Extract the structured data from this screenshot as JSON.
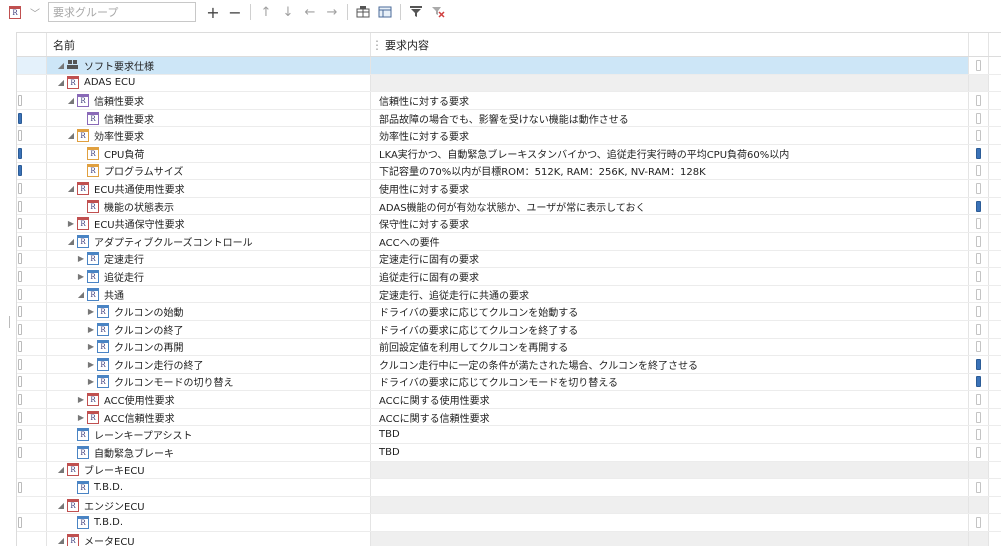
{
  "toolbar": {
    "group_placeholder": "要求グループ",
    "icons": [
      "requirement-icon",
      "dropdown-icon",
      "add-icon",
      "remove-icon",
      "move-up-icon",
      "move-down-icon",
      "move-left-icon",
      "move-right-icon",
      "table-icon",
      "image-icon",
      "filter-icon",
      "clear-filter-icon"
    ]
  },
  "columns": {
    "name": "名前",
    "content": "要求内容"
  },
  "rows": [
    {
      "level": 0,
      "toggle": "open",
      "icon": "package",
      "name": "ソフト要求仕様",
      "content": "",
      "mark": "none",
      "extra": false,
      "selected": true,
      "grey": false
    },
    {
      "level": 0,
      "toggle": "open",
      "icon": "red",
      "name": "ADAS ECU",
      "content": "",
      "mark": "none",
      "extra": false,
      "selected": false,
      "grey": true
    },
    {
      "level": 1,
      "toggle": "open",
      "icon": "purple",
      "name": "信頼性要求",
      "content": "信頼性に対する要求",
      "mark": "off",
      "extra": false,
      "selected": false,
      "grey": false
    },
    {
      "level": 2,
      "toggle": "none",
      "icon": "purple",
      "name": "信頼性要求",
      "content": "部品故障の場合でも、影響を受けない機能は動作させる",
      "mark": "on",
      "extra": false,
      "selected": false,
      "grey": false
    },
    {
      "level": 1,
      "toggle": "open",
      "icon": "orange",
      "name": "効率性要求",
      "content": "効率性に対する要求",
      "mark": "off",
      "extra": false,
      "selected": false,
      "grey": false
    },
    {
      "level": 2,
      "toggle": "none",
      "icon": "orange",
      "name": "CPU負荷",
      "content": "LKA実行かつ、自動緊急ブレーキスタンバイかつ、追従走行実行時の平均CPU負荷60%以内",
      "mark": "on",
      "extra": true,
      "selected": false,
      "grey": false
    },
    {
      "level": 2,
      "toggle": "none",
      "icon": "orange",
      "name": "プログラムサイズ",
      "content": "下記容量の70%以内が目標ROM：512K, RAM：256K, NV-RAM：128K",
      "mark": "on",
      "extra": false,
      "selected": false,
      "grey": false
    },
    {
      "level": 1,
      "toggle": "open",
      "icon": "red",
      "name": "ECU共通使用性要求",
      "content": "使用性に対する要求",
      "mark": "off",
      "extra": false,
      "selected": false,
      "grey": false
    },
    {
      "level": 2,
      "toggle": "none",
      "icon": "red",
      "name": "機能の状態表示",
      "content": "ADAS機能の何が有効な状態か、ユーザが常に表示しておく",
      "mark": "off",
      "extra": true,
      "selected": false,
      "grey": false
    },
    {
      "level": 1,
      "toggle": "closed",
      "icon": "dark",
      "name": "ECU共通保守性要求",
      "content": "保守性に対する要求",
      "mark": "off",
      "extra": false,
      "selected": false,
      "grey": false
    },
    {
      "level": 1,
      "toggle": "open",
      "icon": "blue",
      "name": "アダプティブクルーズコントロール",
      "content": "ACCへの要件",
      "mark": "off",
      "extra": false,
      "selected": false,
      "grey": false
    },
    {
      "level": 2,
      "toggle": "closed",
      "icon": "blue",
      "name": "定速走行",
      "content": "定速走行に固有の要求",
      "mark": "off",
      "extra": false,
      "selected": false,
      "grey": false
    },
    {
      "level": 2,
      "toggle": "closed",
      "icon": "blue",
      "name": "追従走行",
      "content": "追従走行に固有の要求",
      "mark": "off",
      "extra": false,
      "selected": false,
      "grey": false
    },
    {
      "level": 2,
      "toggle": "open",
      "icon": "blue",
      "name": "共通",
      "content": "定速走行、追従走行に共通の要求",
      "mark": "off",
      "extra": false,
      "selected": false,
      "grey": false
    },
    {
      "level": 3,
      "toggle": "closed",
      "icon": "blue",
      "name": "クルコンの始動",
      "content": "ドライバの要求に応じてクルコンを始動する",
      "mark": "off",
      "extra": false,
      "selected": false,
      "grey": false
    },
    {
      "level": 3,
      "toggle": "closed",
      "icon": "blue",
      "name": "クルコンの終了",
      "content": "ドライバの要求に応じてクルコンを終了する",
      "mark": "off",
      "extra": false,
      "selected": false,
      "grey": false
    },
    {
      "level": 3,
      "toggle": "closed",
      "icon": "blue",
      "name": "クルコンの再開",
      "content": "前回設定値を利用してクルコンを再開する",
      "mark": "off",
      "extra": false,
      "selected": false,
      "grey": false
    },
    {
      "level": 3,
      "toggle": "closed",
      "icon": "blue",
      "name": "クルコン走行の終了",
      "content": "クルコン走行中に一定の条件が満たされた場合、クルコンを終了させる",
      "mark": "off",
      "extra": true,
      "selected": false,
      "grey": false
    },
    {
      "level": 3,
      "toggle": "closed",
      "icon": "blue",
      "name": "クルコンモードの切り替え",
      "content": "ドライバの要求に応じてクルコンモードを切り替える",
      "mark": "off",
      "extra": true,
      "selected": false,
      "grey": false
    },
    {
      "level": 2,
      "toggle": "closed",
      "icon": "red",
      "name": "ACC使用性要求",
      "content": "ACCに関する使用性要求",
      "mark": "off",
      "extra": false,
      "selected": false,
      "grey": false
    },
    {
      "level": 2,
      "toggle": "closed",
      "icon": "red",
      "name": "ACC信頼性要求",
      "content": "ACCに関する信頼性要求",
      "mark": "off",
      "extra": false,
      "selected": false,
      "grey": false
    },
    {
      "level": 1,
      "toggle": "none",
      "icon": "blue",
      "name": "レーンキープアシスト",
      "content": "TBD",
      "mark": "off",
      "extra": false,
      "selected": false,
      "grey": false
    },
    {
      "level": 1,
      "toggle": "none",
      "icon": "blue",
      "name": "自動緊急ブレーキ",
      "content": "TBD",
      "mark": "off",
      "extra": false,
      "selected": false,
      "grey": false
    },
    {
      "level": 0,
      "toggle": "open",
      "icon": "red",
      "name": "ブレーキECU",
      "content": "",
      "mark": "none",
      "extra": false,
      "selected": false,
      "grey": true
    },
    {
      "level": 1,
      "toggle": "none",
      "icon": "blue",
      "name": "T.B.D.",
      "content": "",
      "mark": "off",
      "extra": false,
      "selected": false,
      "grey": false
    },
    {
      "level": 0,
      "toggle": "open",
      "icon": "red",
      "name": "エンジンECU",
      "content": "",
      "mark": "none",
      "extra": false,
      "selected": false,
      "grey": true
    },
    {
      "level": 1,
      "toggle": "none",
      "icon": "blue",
      "name": "T.B.D.",
      "content": "",
      "mark": "off",
      "extra": false,
      "selected": false,
      "grey": false
    },
    {
      "level": 0,
      "toggle": "open",
      "icon": "red",
      "name": "メータECU",
      "content": "",
      "mark": "none",
      "extra": false,
      "selected": false,
      "grey": true
    }
  ]
}
